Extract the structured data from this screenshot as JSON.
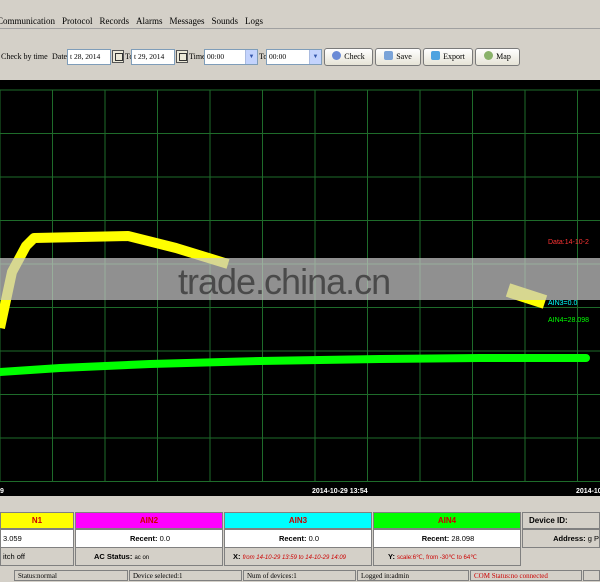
{
  "menu": [
    "Communication",
    "Protocol",
    "Records",
    "Alarms",
    "Messages",
    "Sounds",
    "Logs"
  ],
  "toolbar": {
    "check_by_time_label": "Check by time",
    "date_label": "Date",
    "date_from": "t 28, 2014",
    "to_label": "To",
    "date_to": "t 29, 2014",
    "time_label": "Time",
    "time_from": "00:00",
    "time_to": "00:00",
    "buttons": {
      "check": "Check",
      "save": "Save",
      "export": "Export",
      "map": "Map"
    }
  },
  "chart_data": {
    "type": "line",
    "x_tick_labels": [
      "9",
      "2014-10-29 13:54",
      "2014-10"
    ],
    "series": [
      {
        "name": "AIN3",
        "color": "#ffff00"
      },
      {
        "name": "AIN4",
        "color": "#00ff00"
      }
    ],
    "annotations": {
      "data_label": "Data:14-10-2",
      "ain3_label": "AIN3=0.0",
      "ain4_label": "AIN4=28.098"
    },
    "grid": true
  },
  "watermark": "trade.china.cn",
  "channels": {
    "ain1": "N1",
    "ain2": "AIN2",
    "ain3": "AIN3",
    "ain4": "AIN4",
    "device_id_label": "Device ID:"
  },
  "values": {
    "ain1_value": "3.059",
    "ain2_recent_label": "Recent:",
    "ain2_recent_value": "0.0",
    "ain3_recent_label": "Recent:",
    "ain3_recent_value": "0.0",
    "ain4_recent_label": "Recent:",
    "ain4_recent_value": "28.098",
    "address_label": "Address:",
    "address_value": "g P",
    "switch_text": "itch off",
    "ac_status_label": "AC Status:",
    "ac_status_value": "ac on",
    "x_label": "X:",
    "x_value": "from 14-10-29 13:59 to 14-10-29 14:09",
    "y_label": "Y:",
    "y_value": "scale:6℃, from -30℃ to 64℃"
  },
  "colors": {
    "ain1": "#ffff00",
    "ain2": "#ff00ff",
    "ain3": "#00ffff",
    "ain4": "#00ff00"
  },
  "status": {
    "status": "Status:normal",
    "device_selected": "Device selected:1",
    "num_devices": "Num of devices:1",
    "logged_in": "Logged in:admin",
    "com_status": "COM Status:no connected"
  }
}
